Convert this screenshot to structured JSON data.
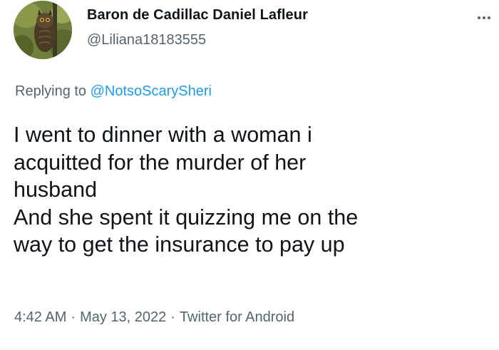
{
  "author": {
    "display_name": "Baron de Cadillac Daniel Lafleur",
    "handle": "@Liliana18183555",
    "avatar_icon": "owl-photo-avatar"
  },
  "reply": {
    "prefix": "Replying to",
    "mention": "@NotsoScarySheri"
  },
  "tweet": {
    "lines": [
      "I went to dinner with a woman i",
      "acquitted for the murder of her",
      "husband",
      "And she spent it quizzing me on the",
      "way to get the insurance to pay up"
    ]
  },
  "meta": {
    "time": "4:42 AM",
    "separator": "·",
    "date": "May 13, 2022",
    "source": "Twitter for Android"
  },
  "colors": {
    "text": "#0f1419",
    "secondary": "#536471",
    "link": "#1d9bf0"
  },
  "icons": {
    "more": "more-options-icon"
  }
}
